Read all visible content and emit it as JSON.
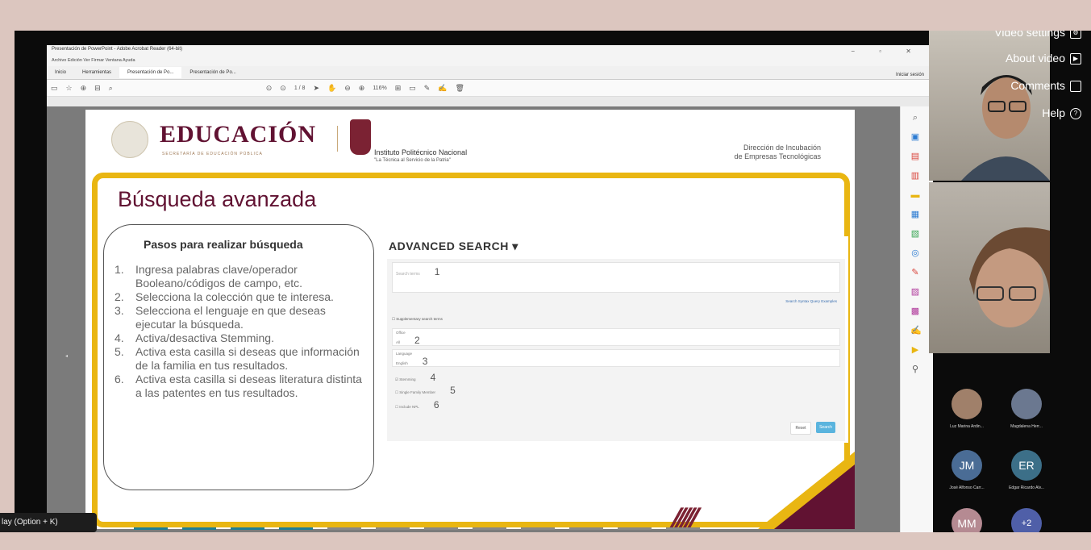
{
  "acrobat": {
    "window_title": "Presentación de PowerPoint - Adobe Acrobat Reader (64-bit)",
    "menu": "Archivo  Edición  Ver  Firmar  Ventana  Ayuda",
    "tabs": [
      "Inicio",
      "Herramientas",
      "Presentación de Po...",
      "Presentación de Po..."
    ],
    "page_indicator": "1 / 8",
    "zoom": "116%",
    "login": "Iniciar sesión"
  },
  "slide": {
    "ministry": "EDUCACIÓN",
    "ministry_sub": "SECRETARÍA DE EDUCACIÓN PÚBLICA",
    "institute": "Instituto Politécnico Nacional",
    "institute_motto": "\"La Técnica al Servicio de la Patria\"",
    "directorate_line1": "Dirección de Incubación",
    "directorate_line2": "de Empresas Tecnológicas",
    "title": "Búsqueda avanzada",
    "steps_title": "Pasos para realizar búsqueda",
    "steps": [
      {
        "n": "1.",
        "text": "Ingresa palabras clave/operador Booleano/códigos de campo, etc."
      },
      {
        "n": "2.",
        "text": "Selecciona la colección que te interesa."
      },
      {
        "n": "3.",
        "text": "Selecciona el lenguaje en que deseas ejecutar la búsqueda."
      },
      {
        "n": "4.",
        "text": "Activa/desactiva Stemming."
      },
      {
        "n": "5.",
        "text": "Activa esta casilla si deseas que información de la familia en tus resultados."
      },
      {
        "n": "6.",
        "text": "Activa esta casilla si deseas literatura distinta a las patentes en tus resultados."
      }
    ],
    "advanced": {
      "heading": "ADVANCED SEARCH",
      "caret": "▾",
      "query_placeholder": "Search terms",
      "markers": [
        "1",
        "2",
        "3",
        "4",
        "5",
        "6"
      ],
      "links": "Search Syntax   Query Examples",
      "checkbox_label": "Supplementary search terms",
      "office_label": "Office",
      "office_value": "All",
      "language_label": "Language",
      "language_value": "English",
      "stemming_label": "Stemming",
      "family_label": "Single Family Member",
      "nonpatent_label": "Include NPL",
      "reset": "Reset",
      "search": "Search"
    }
  },
  "meeting_menu": {
    "video_settings": "Video settings",
    "about_video": "About video",
    "comments": "Comments",
    "help": "Help"
  },
  "participants": [
    {
      "initials": "",
      "name": "Luz Marina Ardin...",
      "color": "#a0806a"
    },
    {
      "initials": "",
      "name": "Magdalena Herr...",
      "color": "#6b7890"
    },
    {
      "initials": "JM",
      "name": "José Alfonso Carr...",
      "color": "#4a6c95"
    },
    {
      "initials": "ER",
      "name": "Edgar Ricardo Alv...",
      "color": "#3c6f88"
    },
    {
      "initials": "MM",
      "name": "",
      "color": "#b58a92"
    },
    {
      "initials": "+2",
      "name": "",
      "color": "#4f5fa8"
    }
  ],
  "tooltip": "lay (Option + K)"
}
